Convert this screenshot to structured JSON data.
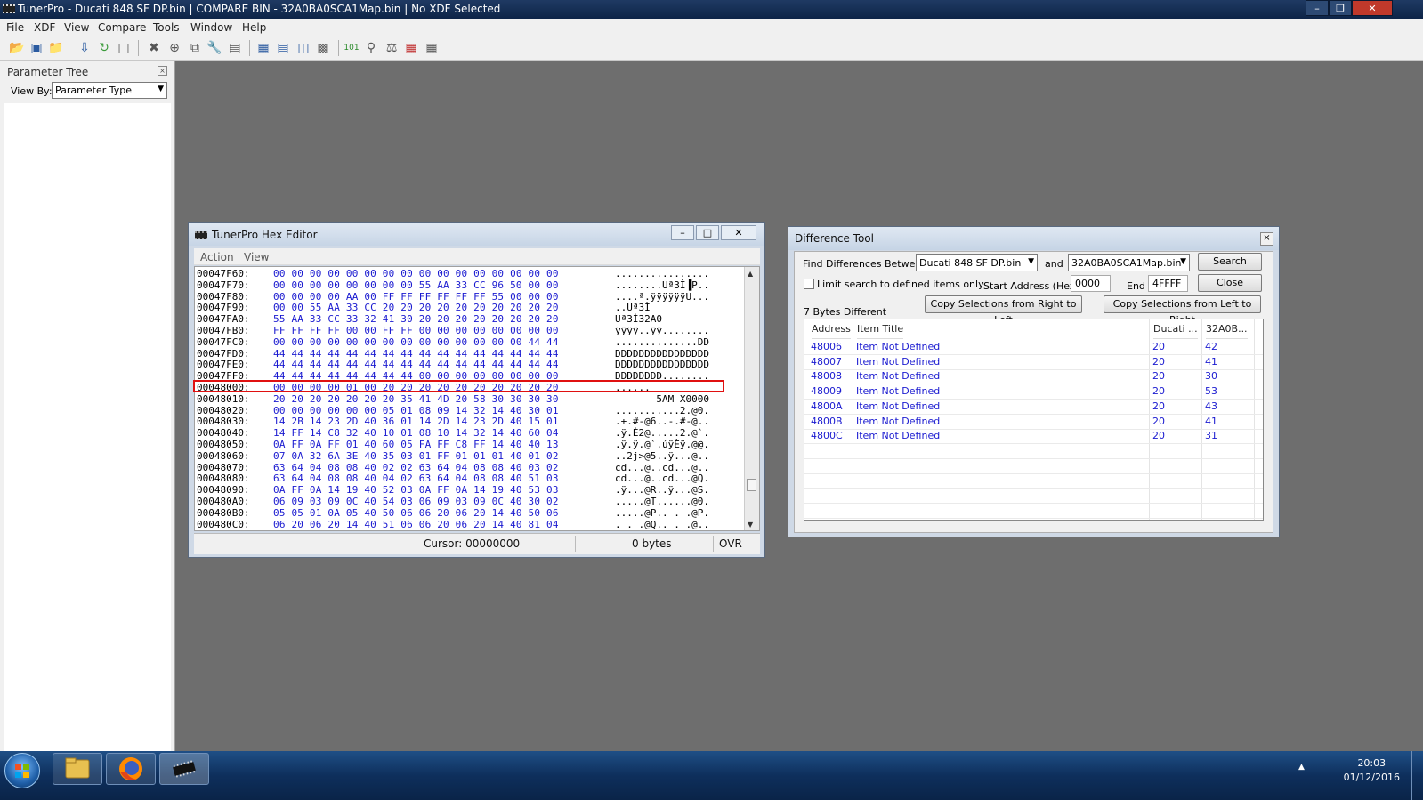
{
  "titlebar": {
    "title": "TunerPro - Ducati 848 SF DP.bin | COMPARE BIN - 32A0BA0SCA1Map.bin | No XDF Selected",
    "minimize": "–",
    "restore": "❐",
    "close": "✕"
  },
  "menu": {
    "items": [
      "File",
      "XDF",
      "View",
      "Compare",
      "Tools",
      "Window",
      "Help"
    ]
  },
  "ptree": {
    "title": "Parameter Tree",
    "close": "×",
    "view_by_label": "View By:",
    "view_by_value": "Parameter Type",
    "arrow": "▼"
  },
  "hex": {
    "title": "TunerPro Hex Editor",
    "btn_min": "–",
    "btn_max": "□",
    "btn_close": "✕",
    "menu": [
      "Action",
      "View"
    ],
    "rows": [
      {
        "addr": "00047F60:",
        "bytes": "00 00 00 00 00 00 00 00 00 00 00 00 00 00 00 00",
        "ascii": "................"
      },
      {
        "addr": "00047F70:",
        "bytes": "00 00 00 00 00 00 00 00 55 AA 33 CC 96 50 00 00",
        "ascii": "........Uª3Ì▐P.."
      },
      {
        "addr": "00047F80:",
        "bytes": "00 00 00 00 AA 00 FF FF FF FF FF FF 55 00 00 00",
        "ascii": "....ª.ÿÿÿÿÿÿU..."
      },
      {
        "addr": "00047F90:",
        "bytes": "00 00 55 AA 33 CC 20 20 20 20 20 20 20 20 20 20",
        "ascii": "..Uª3Ì"
      },
      {
        "addr": "00047FA0:",
        "bytes": "55 AA 33 CC 33 32 41 30 20 20 20 20 20 20 20 20",
        "ascii": "Uª3Ì32A0"
      },
      {
        "addr": "00047FB0:",
        "bytes": "FF FF FF FF 00 00 FF FF 00 00 00 00 00 00 00 00",
        "ascii": "ÿÿÿÿ..ÿÿ........"
      },
      {
        "addr": "00047FC0:",
        "bytes": "00 00 00 00 00 00 00 00 00 00 00 00 00 00 44 44",
        "ascii": "..............DD"
      },
      {
        "addr": "00047FD0:",
        "bytes": "44 44 44 44 44 44 44 44 44 44 44 44 44 44 44 44",
        "ascii": "DDDDDDDDDDDDDDDD"
      },
      {
        "addr": "00047FE0:",
        "bytes": "44 44 44 44 44 44 44 44 44 44 44 44 44 44 44 44",
        "ascii": "DDDDDDDDDDDDDDDD"
      },
      {
        "addr": "00047FF0:",
        "bytes": "44 44 44 44 44 44 44 44 00 00 00 00 00 00 00 00",
        "ascii": "DDDDDDDD........"
      },
      {
        "addr": "00048000:",
        "bytes": "00 00 00 00 01 00 20 20 20 20 20 20 20 20 20 20",
        "ascii": "......"
      },
      {
        "addr": "00048010:",
        "bytes": "20 20 20 20 20 20 20 35 41 4D 20 58 30 30 30 30",
        "ascii": "       5AM X0000"
      },
      {
        "addr": "00048020:",
        "bytes": "00 00 00 00 00 00 05 01 08 09 14 32 14 40 30 01",
        "ascii": "...........2.@0."
      },
      {
        "addr": "00048030:",
        "bytes": "14 2B 14 23 2D 40 36 01 14 2D 14 23 2D 40 15 01",
        "ascii": ".+.#-@6..-.#-@.."
      },
      {
        "addr": "00048040:",
        "bytes": "14 FF 14 C8 32 40 10 01 08 10 14 32 14 40 60 04",
        "ascii": ".ÿ.È2@.....2.@`."
      },
      {
        "addr": "00048050:",
        "bytes": "0A FF 0A FF 01 40 60 05 FA FF C8 FF 14 40 40 13",
        "ascii": ".ÿ.ÿ.@`.úÿÈÿ.@@."
      },
      {
        "addr": "00048060:",
        "bytes": "07 0A 32 6A 3E 40 35 03 01 FF 01 01 01 40 01 02",
        "ascii": "..2j>@5..ÿ...@.."
      },
      {
        "addr": "00048070:",
        "bytes": "63 64 04 08 08 40 02 02 63 64 04 08 08 40 03 02",
        "ascii": "cd...@..cd...@.."
      },
      {
        "addr": "00048080:",
        "bytes": "63 64 04 08 08 40 04 02 63 64 04 08 08 40 51 03",
        "ascii": "cd...@..cd...@Q."
      },
      {
        "addr": "00048090:",
        "bytes": "0A FF 0A 14 19 40 52 03 0A FF 0A 14 19 40 53 03",
        "ascii": ".ÿ...@R..ÿ...@S."
      },
      {
        "addr": "000480A0:",
        "bytes": "06 09 03 09 0C 40 54 03 06 09 03 09 0C 40 30 02",
        "ascii": ".....@T......@0."
      },
      {
        "addr": "000480B0:",
        "bytes": "05 05 01 0A 05 40 50 06 06 20 06 20 14 40 50 06",
        "ascii": ".....@P.. . .@P."
      },
      {
        "addr": "000480C0:",
        "bytes": "06 20 06 20 14 40 51 06 06 20 06 20 14 40 81 04",
        "ascii": ". . .@Q.. . .@.."
      }
    ],
    "status": {
      "cursor": "Cursor: 00000000",
      "bytes": "0 bytes",
      "mode": "OVR"
    },
    "scroll_up": "▲",
    "scroll_down": "▼"
  },
  "diff": {
    "title": "Difference Tool",
    "close": "×",
    "find_label": "Find Differences Between",
    "file_a": "Ducati 848 SF DP.bin",
    "and_label": "and",
    "file_b": "32A0BA0SCA1Map.bin",
    "arrow": "▼",
    "search_btn": "Search",
    "limit_label": "Limit search to defined items only",
    "start_label": "Start Address (Hex)",
    "start_value": "0000",
    "end_label": "End",
    "end_value": "4FFFF",
    "close_btn": "Close",
    "count_label": "7 Bytes Different",
    "copy_rl": "Copy Selections from Right to Left",
    "copy_lr": "Copy Selections from Left to Right",
    "columns": [
      "Address",
      "Item Title",
      "Ducati ...",
      "32A0B..."
    ],
    "rows": [
      {
        "addr": "48006",
        "title": "Item Not Defined",
        "a": "20",
        "b": "42"
      },
      {
        "addr": "48007",
        "title": "Item Not Defined",
        "a": "20",
        "b": "41"
      },
      {
        "addr": "48008",
        "title": "Item Not Defined",
        "a": "20",
        "b": "30"
      },
      {
        "addr": "48009",
        "title": "Item Not Defined",
        "a": "20",
        "b": "53"
      },
      {
        "addr": "4800A",
        "title": "Item Not Defined",
        "a": "20",
        "b": "43"
      },
      {
        "addr": "4800B",
        "title": "Item Not Defined",
        "a": "20",
        "b": "41"
      },
      {
        "addr": "4800C",
        "title": "Item Not Defined",
        "a": "20",
        "b": "31"
      }
    ]
  },
  "taskbar": {
    "start_icon": "windows-orb",
    "apps": [
      "file-explorer-icon",
      "firefox-icon",
      "tunerpro-chip-icon"
    ],
    "tray_arrow": "▲",
    "time": "20:03",
    "date": "01/12/2016"
  },
  "colors": {
    "hex_bytes": "#1a1ad0",
    "highlight": "#e01010",
    "taskbar": "#0e2f5c"
  }
}
